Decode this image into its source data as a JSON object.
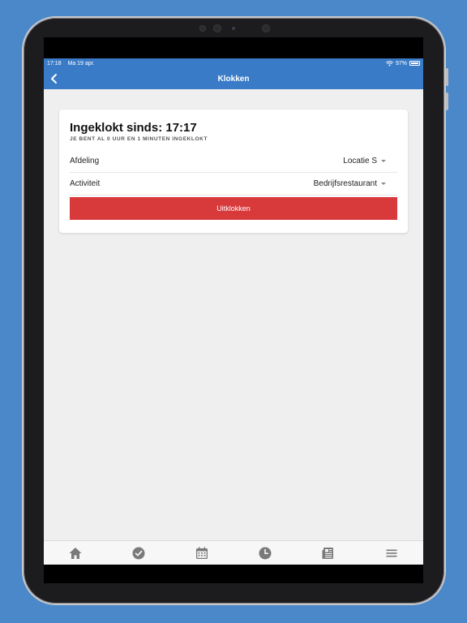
{
  "status_bar": {
    "time": "17:18",
    "date": "Ma 19 apr.",
    "battery": "97%"
  },
  "nav": {
    "title": "Klokken",
    "back_icon": "chevron-left-icon"
  },
  "card": {
    "title": "Ingeklokt sinds: 17:17",
    "subtitle": "JE BENT AL 0 UUR EN 1 MINUTEN INGEKLOKT",
    "fields": [
      {
        "label": "Afdeling",
        "value": "Locatie S"
      },
      {
        "label": "Activiteit",
        "value": "Bedrijfsrestaurant"
      }
    ],
    "button_label": "Uitklokken"
  },
  "tabs": [
    {
      "icon": "home-icon"
    },
    {
      "icon": "check-circle-icon"
    },
    {
      "icon": "calendar-icon"
    },
    {
      "icon": "clock-icon"
    },
    {
      "icon": "news-icon"
    },
    {
      "icon": "menu-icon"
    }
  ],
  "colors": {
    "primary": "#3a7bc8",
    "danger": "#d8393b",
    "background": "#4a88c9"
  }
}
